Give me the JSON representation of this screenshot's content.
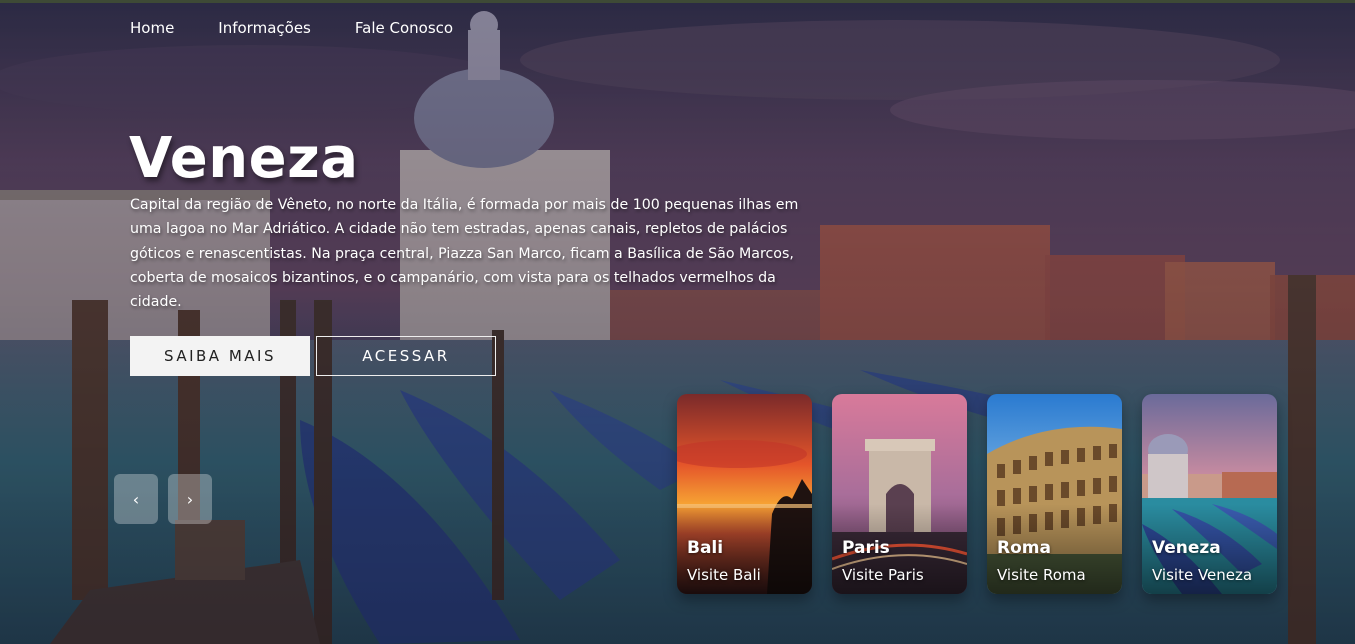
{
  "nav": {
    "items": [
      {
        "label": "Home"
      },
      {
        "label": "Informações"
      },
      {
        "label": "Fale Conosco"
      }
    ]
  },
  "hero": {
    "title": "Veneza",
    "description": "Capital da região de Vêneto, no norte da Itália, é formada por mais de 100 pequenas ilhas em uma lagoa no Mar Adriático. A cidade não tem estradas, apenas canais, repletos de palácios góticos e renascentistas. Na praça central, Piazza San Marco, ficam a Basílica de São Marcos, coberta de mosaicos bizantinos, e o campanário, com vista para os telhados vermelhos da cidade.",
    "primary_button": "SAIBA MAIS",
    "secondary_button": "ACESSAR"
  },
  "slider": {
    "prev_icon": "‹",
    "next_icon": "›"
  },
  "cards": [
    {
      "title": "Bali",
      "subtitle": "Visite Bali"
    },
    {
      "title": "Paris",
      "subtitle": "Visite Paris"
    },
    {
      "title": "Roma",
      "subtitle": "Visite Roma"
    },
    {
      "title": "Veneza",
      "subtitle": "Visite Veneza"
    }
  ],
  "colors": {
    "sky": "#3a3552",
    "water": "#2f5a70",
    "buildings": "#a55a48",
    "gondola": "#2d4a9a",
    "button_light": "#f3f3f3"
  }
}
